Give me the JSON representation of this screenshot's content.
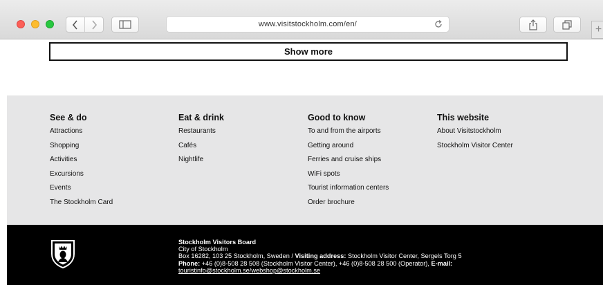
{
  "browser": {
    "url": "www.visitstockholm.com/en/",
    "new_tab_symbol": "+"
  },
  "page": {
    "show_more_label": "Show more"
  },
  "footer": {
    "columns": [
      {
        "heading": "See & do",
        "links": [
          "Attractions",
          "Shopping",
          "Activities",
          "Excursions",
          "Events",
          "The Stockholm Card"
        ]
      },
      {
        "heading": "Eat & drink",
        "links": [
          "Restaurants",
          "Cafés",
          "Nightlife"
        ]
      },
      {
        "heading": "Good to know",
        "links": [
          "To and from the airports",
          "Getting around",
          "Ferries and cruise ships",
          "WiFi spots",
          "Tourist information centers",
          "Order brochure"
        ]
      },
      {
        "heading": "This website",
        "links": [
          "About Visitstockholm",
          "Stockholm Visitor Center"
        ]
      }
    ],
    "board": {
      "name": "Stockholm Visitors Board",
      "city": "City of Stockholm",
      "postal": "Box 16282, 103 25 Stockholm, Sweden / ",
      "visiting_label": "Visiting address:",
      "visiting_value": " Stockholm Visitor Center, Sergels Torg 5",
      "phone_label": "Phone:",
      "phone_value": " +46 (0)8-508 28 508 (Stockholm Visitor Center), +46 (0)8-508 28 500 (Operator), ",
      "email_label": "E-mail:",
      "email_value": "touristinfo@stockholm.se/webshop@stockholm.se"
    }
  }
}
